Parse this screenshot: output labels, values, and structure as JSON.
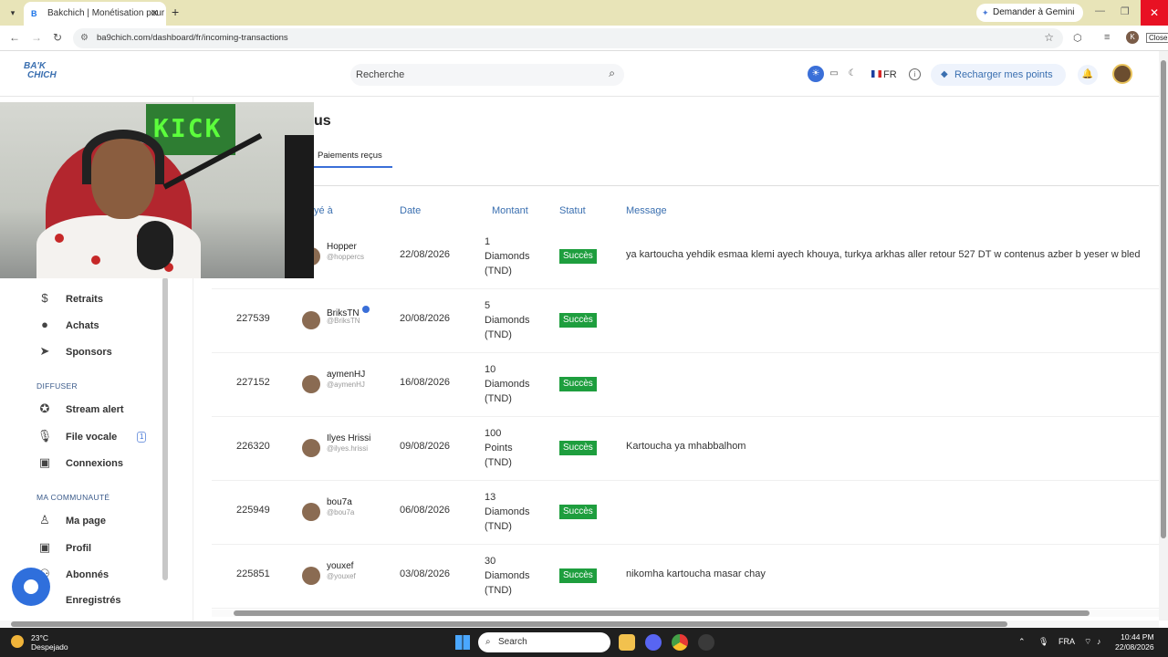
{
  "browser": {
    "tab_title": "Bakchich | Monétisation pour le",
    "tab_favicon": "B",
    "gemini_label": "Demander à Gemini",
    "url": "ba9chich.com/dashboard/fr/incoming-transactions",
    "close_tooltip": "Close",
    "profile_initial": "K"
  },
  "header": {
    "logo_line1": "BA'K",
    "logo_line2": "CHICH",
    "search_placeholder": "Recherche",
    "language": "FR",
    "recharge_label": "Recharger mes points"
  },
  "sidebar": {
    "items_top": [
      {
        "label": "Retraits",
        "icon": "dollar-circle-icon"
      },
      {
        "label": "Achats",
        "icon": "coin-icon"
      },
      {
        "label": "Sponsors",
        "icon": "send-icon"
      }
    ],
    "section_diffuser": "DIFFUSER",
    "items_diffuser": [
      {
        "label": "Stream alert",
        "icon": "star-circle-icon"
      },
      {
        "label": "File vocale",
        "icon": "mic-icon",
        "badge": "1"
      },
      {
        "label": "Connexions",
        "icon": "user-square-icon"
      }
    ],
    "section_communaute": "MA COMMUNAUTÉ",
    "items_communaute": [
      {
        "label": "Ma page",
        "icon": "person-icon"
      },
      {
        "label": "Profil",
        "icon": "user-square-icon"
      },
      {
        "label": "Abonnés",
        "icon": "users-icon"
      },
      {
        "label": "Enregistrés",
        "icon": "bookmark-icon"
      }
    ]
  },
  "main": {
    "title_partial": "us",
    "tab_received": "Paiements reçus",
    "columns": {
      "paid_to": "yé à",
      "date": "Date",
      "amount": "Montant",
      "status": "Statut",
      "message": "Message"
    },
    "rows": [
      {
        "id": "",
        "name": "Hopper",
        "handle": "@hoppercs",
        "verified": false,
        "date": "22/08/2026",
        "amount_num": "1",
        "amount_unit": "Diamonds",
        "amount_cur": "(TND)",
        "status": "Succès",
        "message": "ya kartoucha yehdik esmaa klemi ayech khouya, turkya arkhas aller retour 527 DT w contenus azber b yeser w bled"
      },
      {
        "id": "227539",
        "name": "BriksTN",
        "handle": "@BriksTN",
        "verified": true,
        "date": "20/08/2026",
        "amount_num": "5",
        "amount_unit": "Diamonds",
        "amount_cur": "(TND)",
        "status": "Succès",
        "message": ""
      },
      {
        "id": "227152",
        "name": "aymenHJ",
        "handle": "@aymenHJ",
        "verified": false,
        "date": "16/08/2026",
        "amount_num": "10",
        "amount_unit": "Diamonds",
        "amount_cur": "(TND)",
        "status": "Succès",
        "message": ""
      },
      {
        "id": "226320",
        "name": "Ilyes Hrissi",
        "handle": "@ilyes.hrissi",
        "verified": false,
        "date": "09/08/2026",
        "amount_num": "100",
        "amount_unit": "Points",
        "amount_cur": "(TND)",
        "status": "Succès",
        "message": "Kartoucha ya mhabbalhom"
      },
      {
        "id": "225949",
        "name": "bou7a",
        "handle": "@bou7a",
        "verified": false,
        "date": "06/08/2026",
        "amount_num": "13",
        "amount_unit": "Diamonds",
        "amount_cur": "(TND)",
        "status": "Succès",
        "message": ""
      },
      {
        "id": "225851",
        "name": "youxef",
        "handle": "@youxef",
        "verified": false,
        "date": "03/08/2026",
        "amount_num": "30",
        "amount_unit": "Diamonds",
        "amount_cur": "(TND)",
        "status": "Succès",
        "message": "nikomha kartoucha masar chay"
      }
    ]
  },
  "webcam": {
    "sign_text": "KICK"
  },
  "taskbar": {
    "temperature": "23°C",
    "weather": "Despejado",
    "search_label": "Search",
    "language": "FRA",
    "time": "10:44 PM",
    "date": "22/08/2026"
  },
  "colors": {
    "accent": "#3a6fd8",
    "success": "#1e9e3e",
    "tabbar": "#e8e4b8"
  }
}
